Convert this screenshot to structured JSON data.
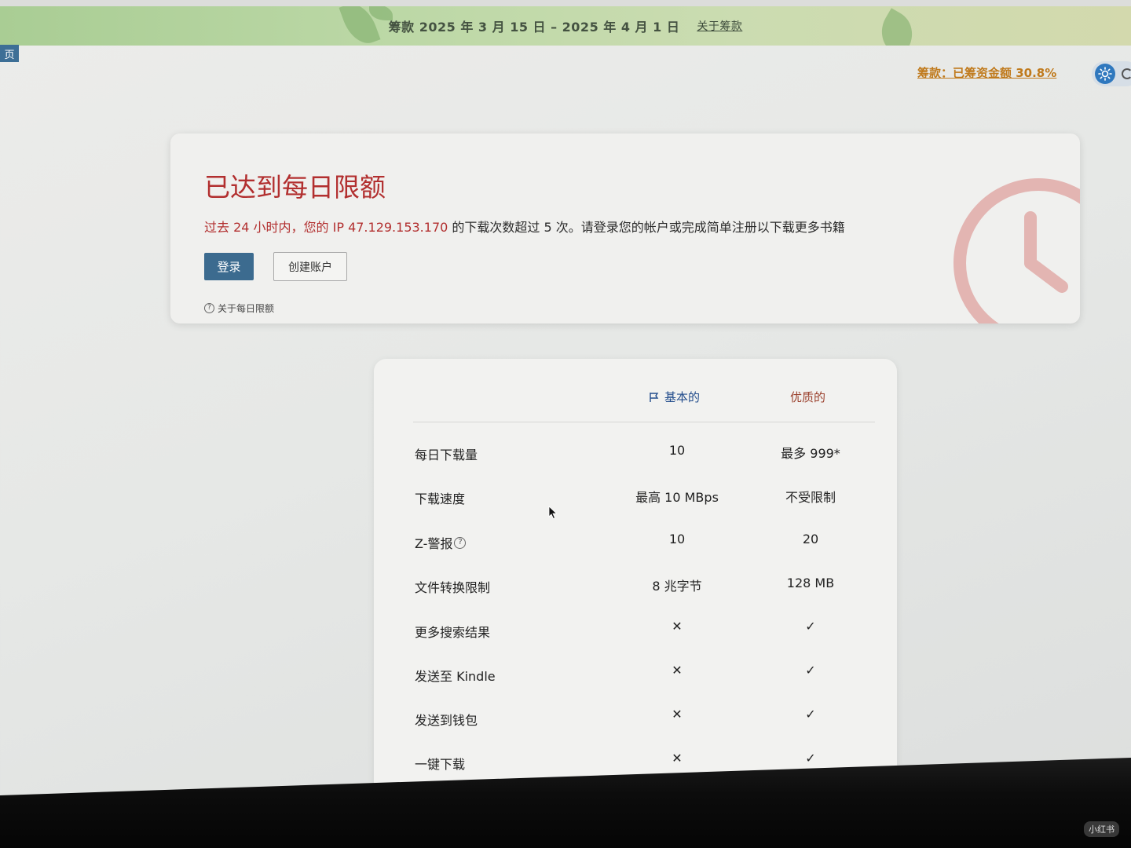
{
  "banner": {
    "text": "筹款 2025 年 3 月 15 日 – 2025 年 4 月 1 日",
    "link": "关于筹款"
  },
  "nav": {
    "home_tab": "页"
  },
  "fundraising": {
    "progress_label": "筹款：已筹资金额 30.8%"
  },
  "limit": {
    "title": "已达到每日限额",
    "msg_red": "过去 24 小时内，您的 IP 47.129.153.170",
    "msg_rest": " 的下载次数超过 5 次。请登录您的帐户或完成简单注册以下载更多书籍",
    "login_label": "登录",
    "create_label": "创建账户",
    "about_label": "关于每日限额",
    "accent_color": "#b22f2f"
  },
  "compare": {
    "basic_header": "基本的",
    "premium_header": "优质的",
    "rows": [
      {
        "label": "每日下载量",
        "basic": "10",
        "premium": "最多 999*"
      },
      {
        "label": "下载速度",
        "basic": "最高 10 MBps",
        "premium": "不受限制"
      },
      {
        "label": "Z-警报",
        "basic": "10",
        "premium": "20"
      },
      {
        "label": "文件转换限制",
        "basic": "8 兆字节",
        "premium": "128 MB"
      },
      {
        "label": "更多搜索结果",
        "basic": "✕",
        "premium": "✓"
      },
      {
        "label": "发送至 Kindle",
        "basic": "✕",
        "premium": "✓"
      },
      {
        "label": "发送到钱包",
        "basic": "✕",
        "premium": "✓"
      },
      {
        "label": "一键下载",
        "basic": "✕",
        "premium": "✓"
      }
    ]
  },
  "watermark": "小红书"
}
